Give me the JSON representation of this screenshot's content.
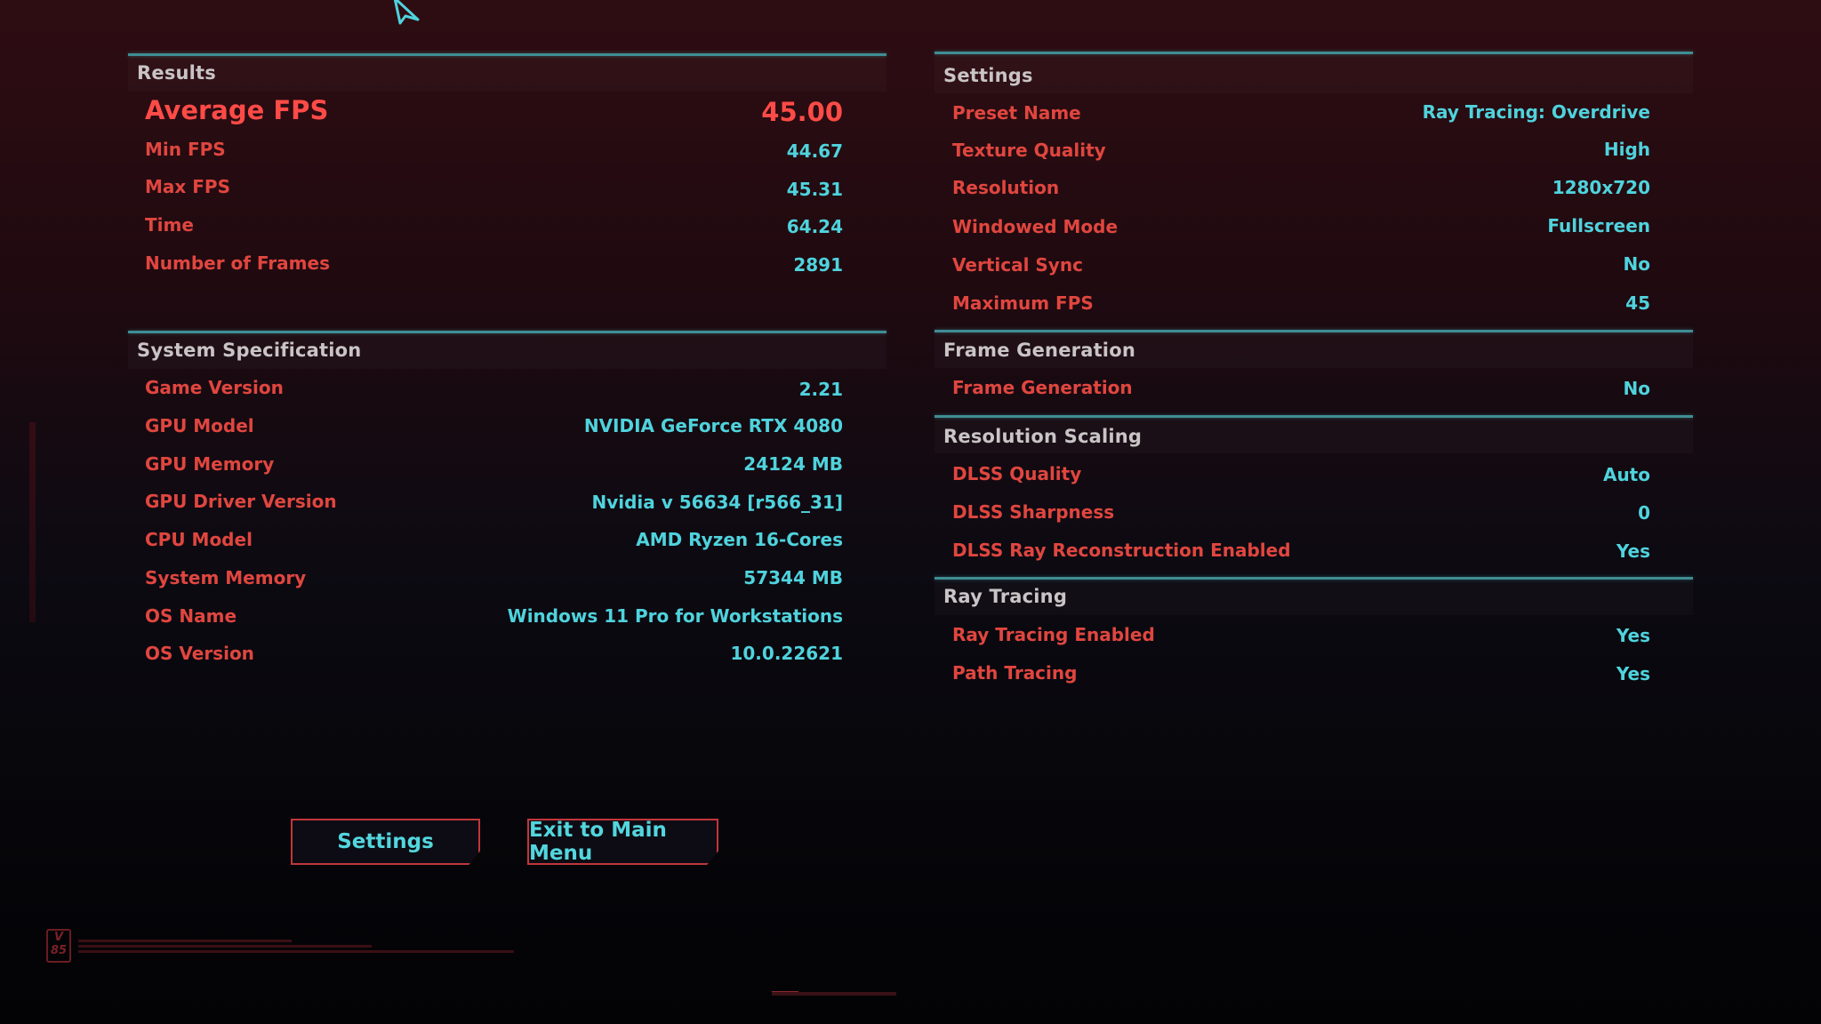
{
  "results": {
    "title": "Results",
    "average": {
      "label": "Average FPS",
      "value": "45.00"
    },
    "rows": [
      {
        "label": "Min FPS",
        "value": "44.67"
      },
      {
        "label": "Max FPS",
        "value": "45.31"
      },
      {
        "label": "Time",
        "value": "64.24"
      },
      {
        "label": "Number of Frames",
        "value": "2891"
      }
    ]
  },
  "system_spec": {
    "title": "System Specification",
    "rows": [
      {
        "label": "Game Version",
        "value": "2.21"
      },
      {
        "label": "GPU Model",
        "value": "NVIDIA GeForce RTX 4080"
      },
      {
        "label": "GPU Memory",
        "value": "24124 MB"
      },
      {
        "label": "GPU Driver Version",
        "value": "Nvidia v 56634 [r566_31]"
      },
      {
        "label": "CPU Model",
        "value": "AMD Ryzen 16-Cores"
      },
      {
        "label": "System Memory",
        "value": "57344 MB"
      },
      {
        "label": "OS Name",
        "value": "Windows 11 Pro for Workstations"
      },
      {
        "label": "OS Version",
        "value": "10.0.22621"
      }
    ]
  },
  "settings": {
    "title": "Settings",
    "rows": [
      {
        "label": "Preset Name",
        "value": "Ray Tracing: Overdrive"
      },
      {
        "label": "Texture Quality",
        "value": "High"
      },
      {
        "label": "Resolution",
        "value": "1280x720"
      },
      {
        "label": "Windowed Mode",
        "value": "Fullscreen"
      },
      {
        "label": "Vertical Sync",
        "value": "No"
      },
      {
        "label": "Maximum FPS",
        "value": "45"
      }
    ]
  },
  "frame_generation": {
    "title": "Frame Generation",
    "rows": [
      {
        "label": "Frame Generation",
        "value": "No"
      }
    ]
  },
  "resolution_scaling": {
    "title": "Resolution Scaling",
    "rows": [
      {
        "label": "DLSS Quality",
        "value": "Auto"
      },
      {
        "label": "DLSS Sharpness",
        "value": "0"
      },
      {
        "label": "DLSS Ray Reconstruction Enabled",
        "value": "Yes"
      }
    ]
  },
  "ray_tracing": {
    "title": "Ray Tracing",
    "rows": [
      {
        "label": "Ray Tracing Enabled",
        "value": "Yes"
      },
      {
        "label": "Path Tracing",
        "value": "Yes"
      }
    ]
  },
  "buttons": {
    "settings": "Settings",
    "exit": "Exit to Main Menu"
  },
  "logo": {
    "line1": "V",
    "line2": "85"
  },
  "icons": {
    "cursor": "mouse-pointer-icon"
  },
  "colors": {
    "label_red": "#e0463f",
    "value_cyan": "#4fd3dd",
    "header_gray": "#c9c4c6",
    "divider_teal": "#3f8d94",
    "button_border": "#c1363a"
  }
}
